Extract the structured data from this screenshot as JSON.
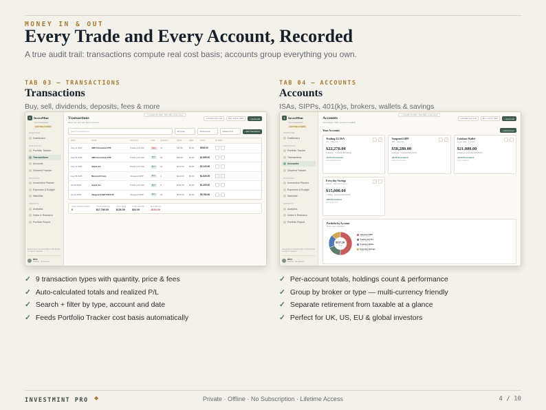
{
  "header": {
    "kicker": "MONEY IN & OUT",
    "title": "Every Trade and Every Account, Recorded",
    "subtitle": "A true audit trail: transactions compute real cost basis; accounts group everything you own."
  },
  "sidebar": {
    "brand": "InvestMint",
    "brand_sub": "Your investments",
    "lifetime_badge": "LIFETIME ACCESS",
    "groups": [
      {
        "label": "OVERVIEW",
        "items": [
          "Dashboard"
        ]
      },
      {
        "label": "PORTFOLIO",
        "items": [
          "Portfolio Tracker",
          "Transactions",
          "Accounts",
          "Dividend Tracker"
        ]
      },
      {
        "label": "PLANNING",
        "items": [
          "Investment Planner",
          "Expenses & Budget",
          "Watchlist"
        ]
      },
      {
        "label": "INSIGHTS",
        "items": [
          "Analytics",
          "Notes & Research",
          "Portfolio Report"
        ]
      }
    ],
    "privacy": "Everything is stored locally on this device, no sign-in required",
    "user_name": "Alex",
    "user_plan": "Lifetime · All features"
  },
  "left": {
    "tab_kicker": "TAB 03 — TRANSACTIONS",
    "title": "Transactions",
    "desc": "Buy, sell, dividends, deposits, fees & more",
    "screen": {
      "title": "Transactions",
      "subtitle": "Every buy, sell, and cash movement",
      "topbar": "⌂ InvestMint Pro 2026 · Work offline on any device",
      "privacy_chip": "● All data stays local",
      "date_chip": "Mon, Aug 24, 2026",
      "quick_add": "+ Quick Add",
      "search_placeholder": "Search transactions...",
      "filter_type": "All Types",
      "filter_account": "All Accounts",
      "filter_date": "Newest First",
      "add_button": "+ Add Transaction",
      "columns": [
        "DATE",
        "ASSET",
        "ACCOUNT",
        "TYPE",
        "QUANTITY",
        "PRICE",
        "FEES",
        "TOTAL",
        "ACTIONS"
      ],
      "rows": [
        {
          "date": "Aug 24 2026",
          "asset": "ARK Innovation ETF",
          "account": "Trading 212 ISA",
          "type": "SELL",
          "qty": "12",
          "price": "$41.50",
          "fees": "$2.00",
          "total": "$516.00"
        },
        {
          "date": "Aug 18 2026",
          "asset": "ARK Innovation ETF",
          "account": "Trading 212 ISA",
          "type": "BUY",
          "qty": "50",
          "price": "$39.20",
          "fees": "$0.00",
          "total": "$1,960.00"
        },
        {
          "date": "Aug 12 2026",
          "asset": "Apple Inc.",
          "account": "Trading 212 ISA",
          "type": "BUY",
          "qty": "10",
          "price": "$212.00",
          "fees": "$0.00",
          "total": "$2,120.00"
        },
        {
          "date": "Aug 05 2026",
          "asset": "Microsoft Corp.",
          "account": "Vanguard SIPP",
          "type": "BUY",
          "qty": "4",
          "price": "$410.00",
          "fees": "$0.00",
          "total": "$1,640.00"
        },
        {
          "date": "Jul 28 2026",
          "asset": "Apple Inc.",
          "account": "Trading 212 ISA",
          "type": "BUY",
          "qty": "6",
          "price": "$201.50",
          "fees": "$0.00",
          "total": "$1,209.00"
        },
        {
          "date": "Jul 20 2026",
          "asset": "Vanguard S&P 500 ETF",
          "account": "Vanguard SIPP",
          "type": "BUY",
          "qty": "10",
          "price": "$578.00",
          "fees": "$0.00",
          "total": "$5,780.00"
        }
      ],
      "totals": [
        {
          "label": "TOTAL TRANSACTIONS",
          "value": "6"
        },
        {
          "label": "TOTAL INVESTED",
          "value": "$17,780.00"
        },
        {
          "label": "TOTAL FEES",
          "value": "$136.00"
        },
        {
          "label": "TOTAL INCOME",
          "value": "$22.00"
        },
        {
          "label": "REALIZED P/L",
          "value": "-$104.00"
        }
      ]
    },
    "features": [
      "9 transaction types with quantity, price & fees",
      "Auto-calculated totals and realized P/L",
      "Search + filter by type, account and date",
      "Feeds Portfolio Tracker cost basis automatically"
    ]
  },
  "right": {
    "tab_kicker": "TAB 04 — ACCOUNTS",
    "title": "Accounts",
    "desc": "ISAs, SIPPs, 401(k)s, brokers, wallets & savings",
    "screen": {
      "title": "Accounts",
      "subtitle": "Your brokers, ISAs, pensions & wallets",
      "topbar": "⌂ InvestMint Pro 2026 · Work offline on any device",
      "privacy_chip": "● All data stays local",
      "date_chip": "Mon, Aug 24, 2026",
      "quick_add": "+ Quick Add",
      "section_label": "Your Accounts",
      "add_button": "+ Add Account",
      "accounts": [
        {
          "name": "Trading 212 ISA",
          "sub": "ISA · Trading 212",
          "value": "$22,270.00",
          "meta": "5 holdings · Cost basis $21,000.00",
          "gain": "+$1,270.00 unrealised",
          "meta2": "Last updated Aug 24"
        },
        {
          "name": "Vanguard SIPP",
          "sub": "SIPP · Vanguard",
          "value": "$58,280.00",
          "meta": "3 holdings · Cost basis $54,100.00",
          "gain": "+$4,180.00 unrealised",
          "meta2": "Retirement account"
        },
        {
          "name": "Coinbase Wallet",
          "sub": "Crypto Wallet · Coinbase",
          "value": "$21,000.00",
          "meta": "2 holdings · Cost basis $18,000.00",
          "gain": "+$3,000.00 unrealised",
          "meta2": "Crypto exposure"
        },
        {
          "name": "Everyday Savings",
          "sub": "Savings · High-interest saver",
          "value": "$15,000.00",
          "meta": "1 holding · Cost basis $15,000.00",
          "gain": "+$600.00 unrealised",
          "meta2": "Emergency fund"
        }
      ],
      "portfolio_title": "Portfolio by Account",
      "portfolio_sub": "Market value distribution",
      "donut_center_value": "$117,1K",
      "donut_center_label": "Total",
      "legend": [
        {
          "name": "Vanguard SIPP",
          "pct": "49.8% · $58.3K",
          "color": "#c55b5b"
        },
        {
          "name": "Trading 212 ISA",
          "pct": "19.0% · $22.3K",
          "color": "#5b7f6c"
        },
        {
          "name": "Coinbase Wallet",
          "pct": "17.9% · $21.0K",
          "color": "#4f79b8"
        },
        {
          "name": "Everyday Savings",
          "pct": "12.8% · $15.0K",
          "color": "#d1a659"
        }
      ]
    },
    "features": [
      "Per-account totals, holdings count & performance",
      "Group by broker or type — multi-currency friendly",
      "Separate retirement from taxable at a glance",
      "Perfect for UK, US, EU & global investors"
    ]
  },
  "footer": {
    "brand": "INVESTMINT PRO",
    "diamond": "◆",
    "tagline": "Private · Offline · No Subscription · Lifetime Access",
    "page": "4 / 10"
  },
  "colors": {
    "accent_gold": "#a77b33",
    "brand_green": "#3d5a4c",
    "background": "#f4f1ea",
    "check_green": "#3f7a58"
  }
}
